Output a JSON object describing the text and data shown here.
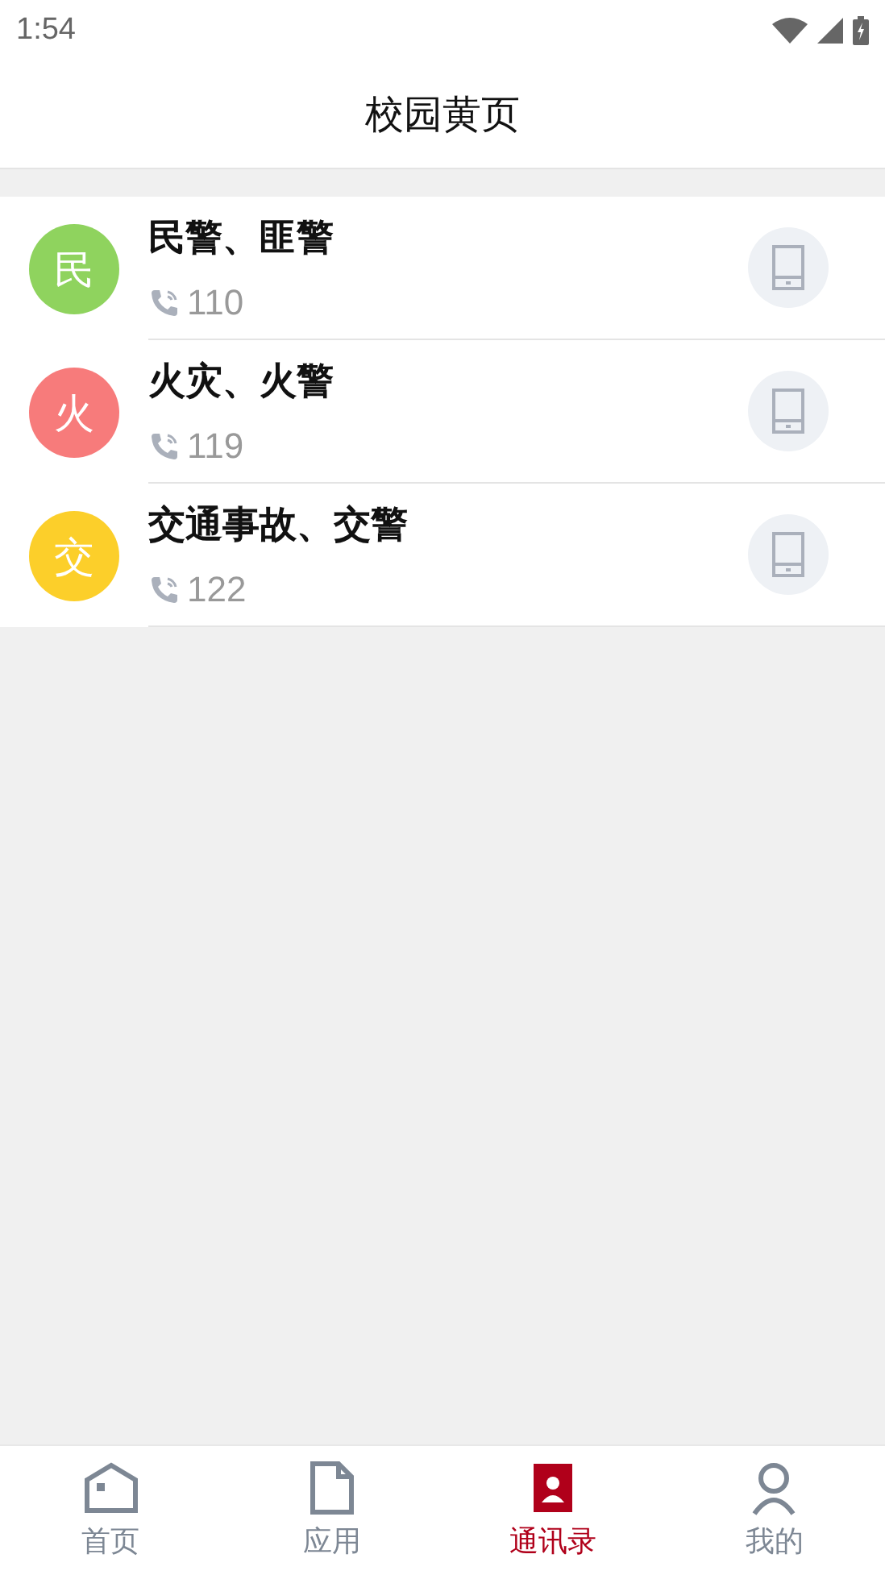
{
  "status_bar": {
    "time": "1:54"
  },
  "header": {
    "title": "校园黄页"
  },
  "contacts": [
    {
      "avatar": "民",
      "color": "#8fd35e",
      "name": "民警、匪警",
      "phone": "110"
    },
    {
      "avatar": "火",
      "color": "#f77b7b",
      "name": "火灾、火警",
      "phone": "119"
    },
    {
      "avatar": "交",
      "color": "#fccf2a",
      "name": "交通事故、交警",
      "phone": "122"
    }
  ],
  "tab_bar": [
    {
      "kind": "home",
      "label": "首页",
      "selected": false
    },
    {
      "kind": "apps",
      "label": "应用",
      "selected": false
    },
    {
      "kind": "contacts",
      "label": "通讯录",
      "selected": true
    },
    {
      "kind": "me",
      "label": "我的",
      "selected": false
    }
  ]
}
